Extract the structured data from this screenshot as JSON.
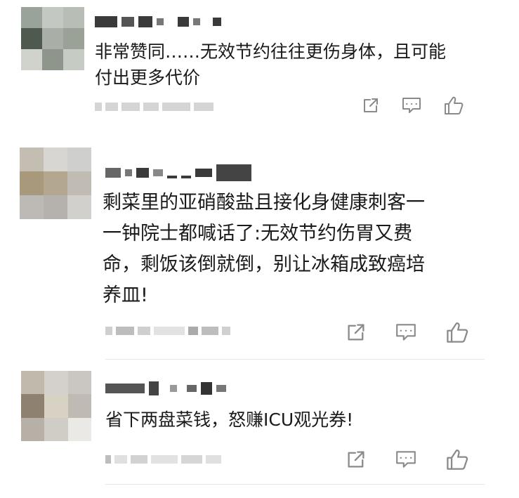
{
  "comments": [
    {
      "text": "非常赞同……无效节约往往更伤身体，且可能\n付出更多代价",
      "actions": {
        "share_icon": "share-icon",
        "reply_icon": "comment-icon",
        "like_icon": "thumbs-up-icon"
      }
    },
    {
      "text": "剩菜里的亚硝酸盐且接化身健康刺客一\n一钟院士都喊话了:无效节约伤胃又费\n命，剩饭该倒就倒，别让冰箱成致癌培\n养皿!",
      "actions": {
        "share_icon": "share-icon",
        "reply_icon": "comment-icon",
        "like_icon": "thumbs-up-icon"
      }
    },
    {
      "text": "省下两盘菜钱，怒赚ICU观光券!",
      "actions": {
        "share_icon": "share-icon",
        "reply_icon": "comment-icon",
        "like_icon": "thumbs-up-icon"
      }
    }
  ],
  "colors": {
    "text": "#1a1a1a",
    "icon": "#8a8a8a",
    "meta": "#d4d4d4",
    "divider": "#e6e6e6"
  }
}
